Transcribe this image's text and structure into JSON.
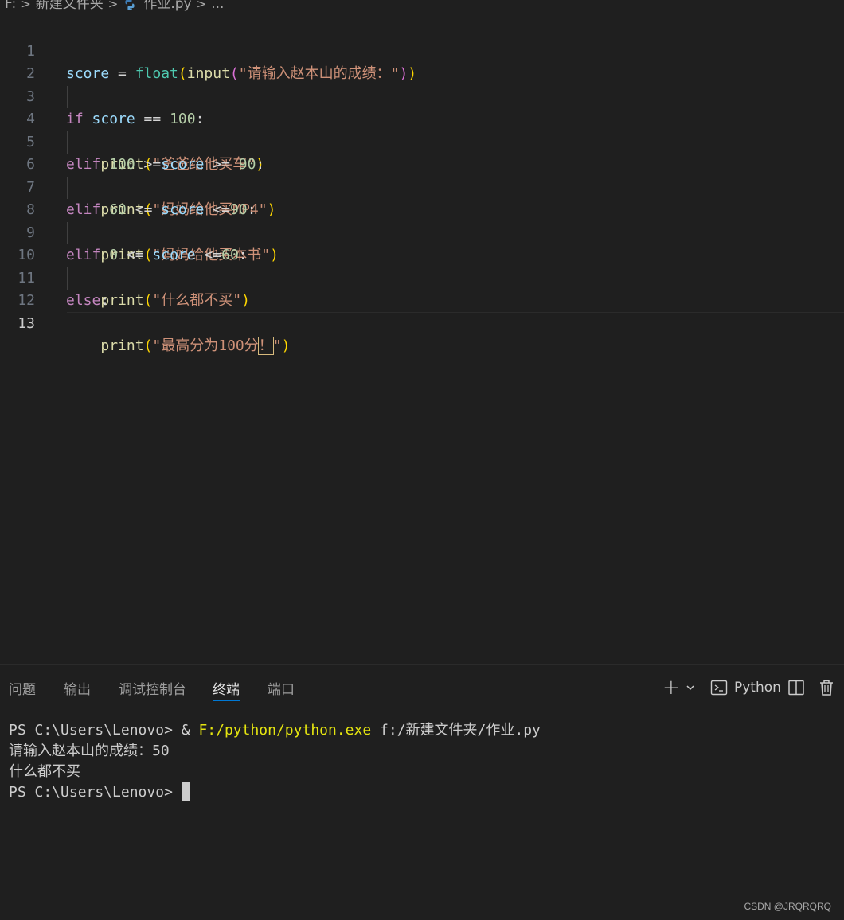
{
  "breadcrumb": {
    "drive": "F:",
    "folder": "新建文件夹",
    "file": "作业.py",
    "more": "..."
  },
  "editor": {
    "line_numbers": [
      "1",
      "2",
      "3",
      "4",
      "5",
      "6",
      "7",
      "8",
      "9",
      "10",
      "11",
      "12",
      "13"
    ],
    "active_line": "13",
    "lines": [
      {
        "tokens": [
          "score",
          " = ",
          "float",
          "(",
          "input",
          "(",
          "\"请输入赵本山的成绩：\"",
          ")",
          ")"
        ]
      },
      {
        "tokens": []
      },
      {
        "tokens": [
          "if",
          " ",
          "score",
          " == ",
          "100",
          ":"
        ]
      },
      {
        "tokens": [
          "print",
          "(",
          "\"爸爸给他买车\"",
          ")"
        ]
      },
      {
        "tokens": [
          "elif",
          " ",
          "100",
          " >=",
          "score",
          " >= ",
          "90",
          ":"
        ]
      },
      {
        "tokens": [
          "print",
          "(",
          "\"妈妈给他买MP4\"",
          ")"
        ]
      },
      {
        "tokens": [
          "elif",
          " ",
          "60",
          " <= ",
          "score",
          " <=",
          "90",
          ":"
        ]
      },
      {
        "tokens": [
          "print",
          "(",
          "\"妈妈给他买本书\"",
          ")"
        ]
      },
      {
        "tokens": [
          "elif",
          " ",
          "0",
          " <= ",
          "score",
          " <=",
          "60",
          ":"
        ]
      },
      {
        "tokens": [
          "print",
          "(",
          "\"什么都不买\"",
          ")"
        ]
      },
      {
        "tokens": [
          "else",
          ":"
        ]
      },
      {
        "tokens": [
          "print",
          "(",
          "\"最高分为100分",
          "！",
          "\"",
          ")"
        ]
      },
      {
        "tokens": []
      }
    ]
  },
  "panel": {
    "tabs": [
      "问题",
      "输出",
      "调试控制台",
      "终端",
      "端口"
    ],
    "active_tab": "终端",
    "toolbar": {
      "add_label": "+",
      "profile_label": "Python"
    }
  },
  "terminal": {
    "line1_prompt": "PS C:\\Users\\Lenovo> ",
    "line1_amp": "& ",
    "line1_exe": "F:/python/python.exe",
    "line1_arg": " f:/新建文件夹/作业.py",
    "line2": "请输入赵本山的成绩：50",
    "line3": "什么都不买",
    "line4_prompt": "PS C:\\Users\\Lenovo> "
  },
  "watermark": "CSDN @JRQRQRQ",
  "colors": {
    "background": "#1f1f1f",
    "keyword": "#c586c0",
    "variable": "#9cdcfe",
    "function": "#dcdcaa",
    "builtin": "#4ec9b0",
    "number": "#b5cea8",
    "string": "#ce9178",
    "bracket1": "#ffd700",
    "bracket2": "#da70d6",
    "tab_underline": "#0078d4"
  }
}
